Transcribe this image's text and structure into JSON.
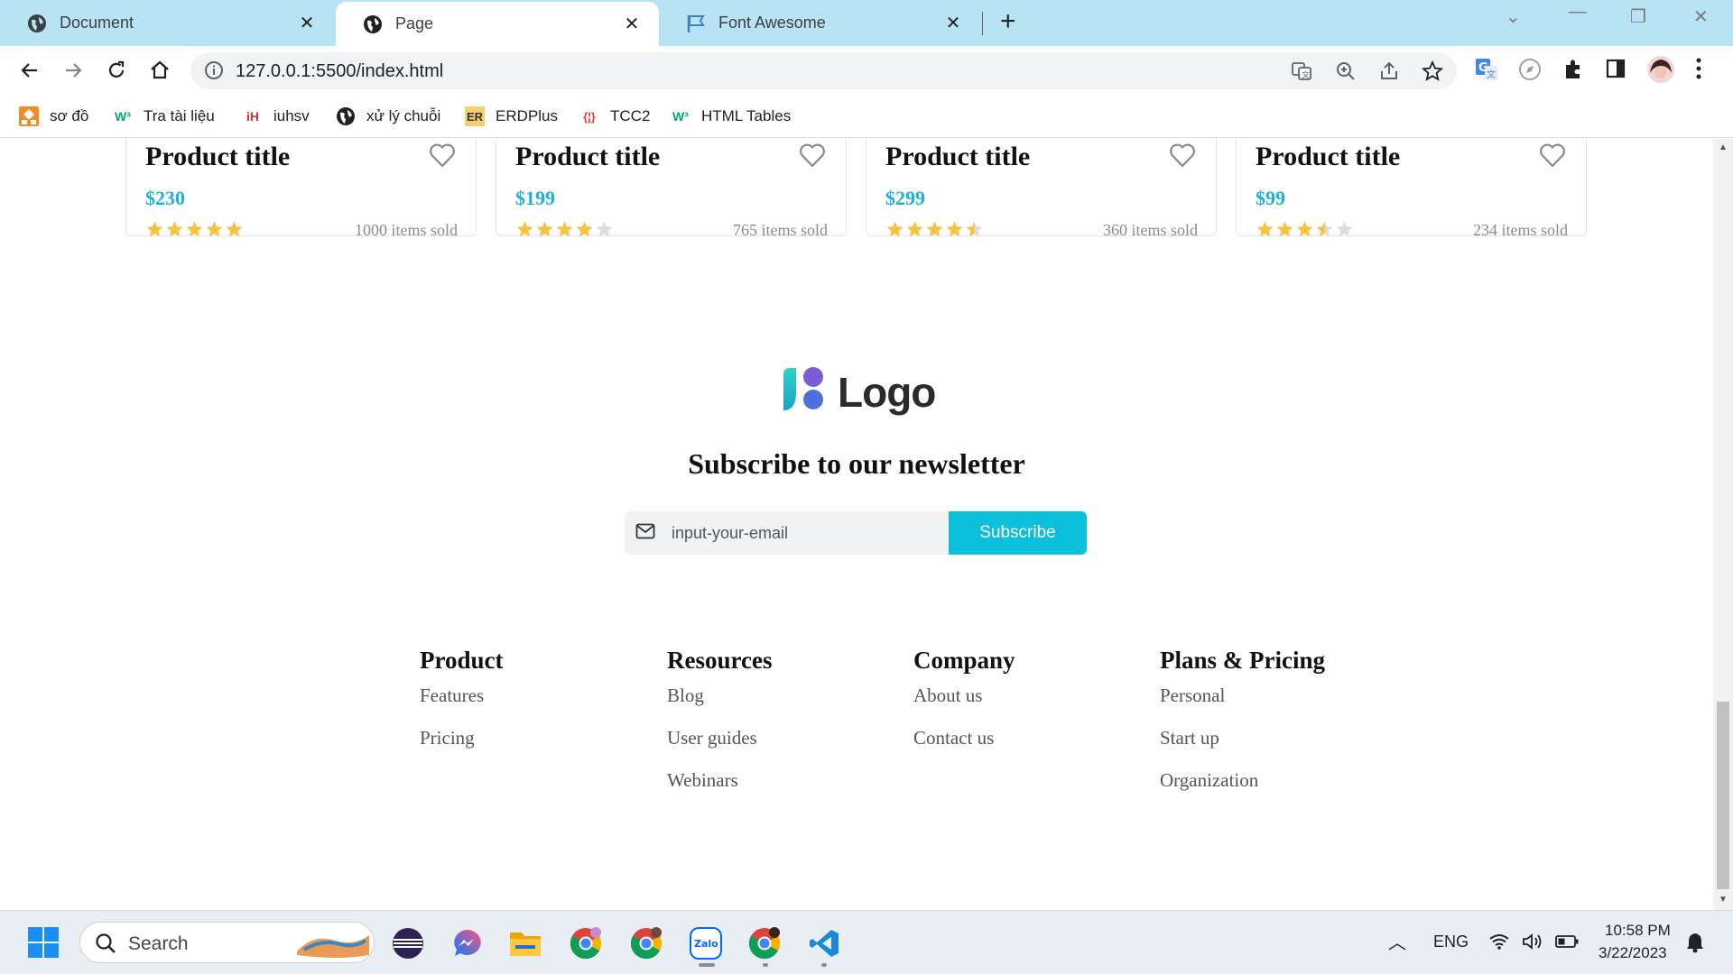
{
  "browser": {
    "tabs": [
      {
        "title": "Document",
        "active": false
      },
      {
        "title": "Page",
        "active": true
      },
      {
        "title": "Font Awesome",
        "active": false
      }
    ],
    "url": "127.0.0.1:5500/index.html",
    "bookmarks": [
      {
        "label": "sơ đồ",
        "icon": "diagram-icon"
      },
      {
        "label": "Tra tài liệu",
        "icon": "w3-icon"
      },
      {
        "label": "iuhsv",
        "icon": "iuh-icon"
      },
      {
        "label": "xử lý chuỗi",
        "icon": "globe-icon"
      },
      {
        "label": "ERDPlus",
        "icon": "er-icon"
      },
      {
        "label": "TCC2",
        "icon": "tcc-icon"
      },
      {
        "label": "HTML Tables",
        "icon": "w3-icon"
      }
    ]
  },
  "products": [
    {
      "title": "Product title",
      "price": "$230",
      "rating": 5,
      "sold": "1000 items sold"
    },
    {
      "title": "Product title",
      "price": "$199",
      "rating": 4,
      "sold": "765 items sold"
    },
    {
      "title": "Product title",
      "price": "$299",
      "rating": 4.5,
      "sold": "360 items sold"
    },
    {
      "title": "Product title",
      "price": "$99",
      "rating": 3.5,
      "sold": "234 items sold"
    }
  ],
  "logo": {
    "text": "Logo"
  },
  "newsletter": {
    "title": "Subscribe to our newsletter",
    "placeholder": "input-your-email",
    "button": "Subscribe"
  },
  "footer": {
    "columns": [
      {
        "heading": "Product",
        "links": [
          "Features",
          "Pricing"
        ]
      },
      {
        "heading": "Resources",
        "links": [
          "Blog",
          "User guides",
          "Webinars"
        ]
      },
      {
        "heading": "Company",
        "links": [
          "About us",
          "Contact us"
        ]
      },
      {
        "heading": "Plans & Pricing",
        "links": [
          "Personal",
          "Start up",
          "Organization"
        ]
      }
    ]
  },
  "taskbar": {
    "search_label": "Search",
    "language": "ENG",
    "time": "10:58 PM",
    "date": "3/22/2023"
  },
  "colors": {
    "accent": "#0cc0dc",
    "price": "#1bb3d6",
    "star": "#f5c242",
    "tabstrip": "#b8e3f2"
  }
}
